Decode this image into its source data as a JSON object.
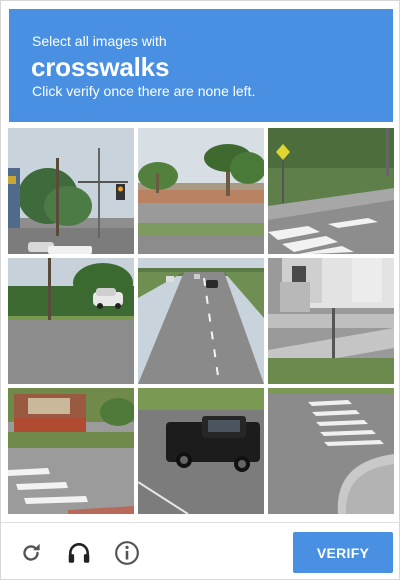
{
  "header": {
    "instruction": "Select all images with",
    "target": "crosswalks",
    "hint": "Click verify once there are none left."
  },
  "tiles": [
    {
      "row": 1,
      "col": 1,
      "scene": "street intersection with traffic light and tree"
    },
    {
      "row": 1,
      "col": 2,
      "scene": "road with palm trees"
    },
    {
      "row": 1,
      "col": 3,
      "scene": "crosswalk with pedestrian sign"
    },
    {
      "row": 2,
      "col": 1,
      "scene": "road with parked car and grass"
    },
    {
      "row": 2,
      "col": 2,
      "scene": "multi-lane highway"
    },
    {
      "row": 2,
      "col": 3,
      "scene": "house with sidewalk"
    },
    {
      "row": 3,
      "col": 1,
      "scene": "brick sign with crosswalk"
    },
    {
      "row": 3,
      "col": 2,
      "scene": "black pickup truck on road"
    },
    {
      "row": 3,
      "col": 3,
      "scene": "crosswalk at curb corner"
    }
  ],
  "footer": {
    "reload_icon": "reload-icon",
    "audio_icon": "headphones-icon",
    "info_icon": "info-icon",
    "verify_label": "VERIFY"
  },
  "colors": {
    "accent": "#4a90e2",
    "icon": "#555555"
  }
}
